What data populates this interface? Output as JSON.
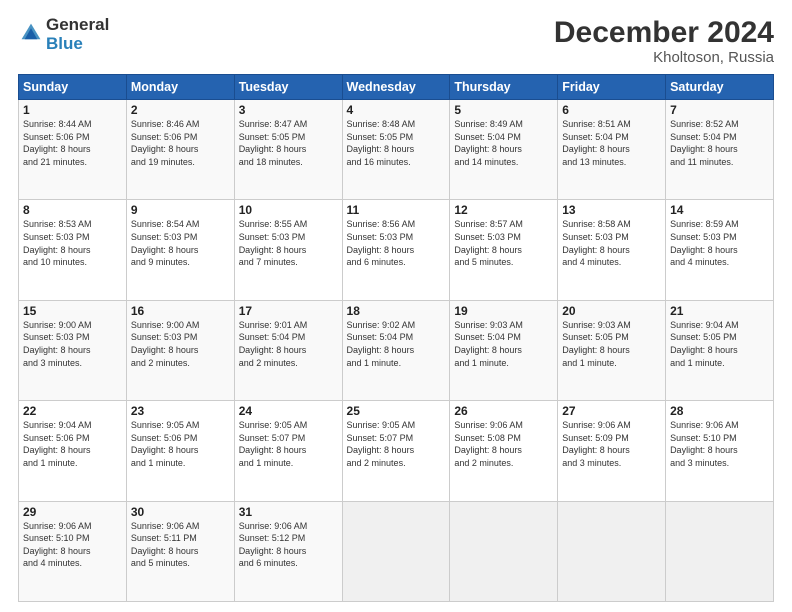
{
  "logo": {
    "general": "General",
    "blue": "Blue"
  },
  "header": {
    "month": "December 2024",
    "location": "Kholtoson, Russia"
  },
  "weekdays": [
    "Sunday",
    "Monday",
    "Tuesday",
    "Wednesday",
    "Thursday",
    "Friday",
    "Saturday"
  ],
  "weeks": [
    [
      {
        "day": "1",
        "lines": [
          "Sunrise: 8:44 AM",
          "Sunset: 5:06 PM",
          "Daylight: 8 hours",
          "and 21 minutes."
        ]
      },
      {
        "day": "2",
        "lines": [
          "Sunrise: 8:46 AM",
          "Sunset: 5:06 PM",
          "Daylight: 8 hours",
          "and 19 minutes."
        ]
      },
      {
        "day": "3",
        "lines": [
          "Sunrise: 8:47 AM",
          "Sunset: 5:05 PM",
          "Daylight: 8 hours",
          "and 18 minutes."
        ]
      },
      {
        "day": "4",
        "lines": [
          "Sunrise: 8:48 AM",
          "Sunset: 5:05 PM",
          "Daylight: 8 hours",
          "and 16 minutes."
        ]
      },
      {
        "day": "5",
        "lines": [
          "Sunrise: 8:49 AM",
          "Sunset: 5:04 PM",
          "Daylight: 8 hours",
          "and 14 minutes."
        ]
      },
      {
        "day": "6",
        "lines": [
          "Sunrise: 8:51 AM",
          "Sunset: 5:04 PM",
          "Daylight: 8 hours",
          "and 13 minutes."
        ]
      },
      {
        "day": "7",
        "lines": [
          "Sunrise: 8:52 AM",
          "Sunset: 5:04 PM",
          "Daylight: 8 hours",
          "and 11 minutes."
        ]
      }
    ],
    [
      {
        "day": "8",
        "lines": [
          "Sunrise: 8:53 AM",
          "Sunset: 5:03 PM",
          "Daylight: 8 hours",
          "and 10 minutes."
        ]
      },
      {
        "day": "9",
        "lines": [
          "Sunrise: 8:54 AM",
          "Sunset: 5:03 PM",
          "Daylight: 8 hours",
          "and 9 minutes."
        ]
      },
      {
        "day": "10",
        "lines": [
          "Sunrise: 8:55 AM",
          "Sunset: 5:03 PM",
          "Daylight: 8 hours",
          "and 7 minutes."
        ]
      },
      {
        "day": "11",
        "lines": [
          "Sunrise: 8:56 AM",
          "Sunset: 5:03 PM",
          "Daylight: 8 hours",
          "and 6 minutes."
        ]
      },
      {
        "day": "12",
        "lines": [
          "Sunrise: 8:57 AM",
          "Sunset: 5:03 PM",
          "Daylight: 8 hours",
          "and 5 minutes."
        ]
      },
      {
        "day": "13",
        "lines": [
          "Sunrise: 8:58 AM",
          "Sunset: 5:03 PM",
          "Daylight: 8 hours",
          "and 4 minutes."
        ]
      },
      {
        "day": "14",
        "lines": [
          "Sunrise: 8:59 AM",
          "Sunset: 5:03 PM",
          "Daylight: 8 hours",
          "and 4 minutes."
        ]
      }
    ],
    [
      {
        "day": "15",
        "lines": [
          "Sunrise: 9:00 AM",
          "Sunset: 5:03 PM",
          "Daylight: 8 hours",
          "and 3 minutes."
        ]
      },
      {
        "day": "16",
        "lines": [
          "Sunrise: 9:00 AM",
          "Sunset: 5:03 PM",
          "Daylight: 8 hours",
          "and 2 minutes."
        ]
      },
      {
        "day": "17",
        "lines": [
          "Sunrise: 9:01 AM",
          "Sunset: 5:04 PM",
          "Daylight: 8 hours",
          "and 2 minutes."
        ]
      },
      {
        "day": "18",
        "lines": [
          "Sunrise: 9:02 AM",
          "Sunset: 5:04 PM",
          "Daylight: 8 hours",
          "and 1 minute."
        ]
      },
      {
        "day": "19",
        "lines": [
          "Sunrise: 9:03 AM",
          "Sunset: 5:04 PM",
          "Daylight: 8 hours",
          "and 1 minute."
        ]
      },
      {
        "day": "20",
        "lines": [
          "Sunrise: 9:03 AM",
          "Sunset: 5:05 PM",
          "Daylight: 8 hours",
          "and 1 minute."
        ]
      },
      {
        "day": "21",
        "lines": [
          "Sunrise: 9:04 AM",
          "Sunset: 5:05 PM",
          "Daylight: 8 hours",
          "and 1 minute."
        ]
      }
    ],
    [
      {
        "day": "22",
        "lines": [
          "Sunrise: 9:04 AM",
          "Sunset: 5:06 PM",
          "Daylight: 8 hours",
          "and 1 minute."
        ]
      },
      {
        "day": "23",
        "lines": [
          "Sunrise: 9:05 AM",
          "Sunset: 5:06 PM",
          "Daylight: 8 hours",
          "and 1 minute."
        ]
      },
      {
        "day": "24",
        "lines": [
          "Sunrise: 9:05 AM",
          "Sunset: 5:07 PM",
          "Daylight: 8 hours",
          "and 1 minute."
        ]
      },
      {
        "day": "25",
        "lines": [
          "Sunrise: 9:05 AM",
          "Sunset: 5:07 PM",
          "Daylight: 8 hours",
          "and 2 minutes."
        ]
      },
      {
        "day": "26",
        "lines": [
          "Sunrise: 9:06 AM",
          "Sunset: 5:08 PM",
          "Daylight: 8 hours",
          "and 2 minutes."
        ]
      },
      {
        "day": "27",
        "lines": [
          "Sunrise: 9:06 AM",
          "Sunset: 5:09 PM",
          "Daylight: 8 hours",
          "and 3 minutes."
        ]
      },
      {
        "day": "28",
        "lines": [
          "Sunrise: 9:06 AM",
          "Sunset: 5:10 PM",
          "Daylight: 8 hours",
          "and 3 minutes."
        ]
      }
    ],
    [
      {
        "day": "29",
        "lines": [
          "Sunrise: 9:06 AM",
          "Sunset: 5:10 PM",
          "Daylight: 8 hours",
          "and 4 minutes."
        ]
      },
      {
        "day": "30",
        "lines": [
          "Sunrise: 9:06 AM",
          "Sunset: 5:11 PM",
          "Daylight: 8 hours",
          "and 5 minutes."
        ]
      },
      {
        "day": "31",
        "lines": [
          "Sunrise: 9:06 AM",
          "Sunset: 5:12 PM",
          "Daylight: 8 hours",
          "and 6 minutes."
        ]
      },
      {
        "day": "",
        "lines": []
      },
      {
        "day": "",
        "lines": []
      },
      {
        "day": "",
        "lines": []
      },
      {
        "day": "",
        "lines": []
      }
    ]
  ]
}
